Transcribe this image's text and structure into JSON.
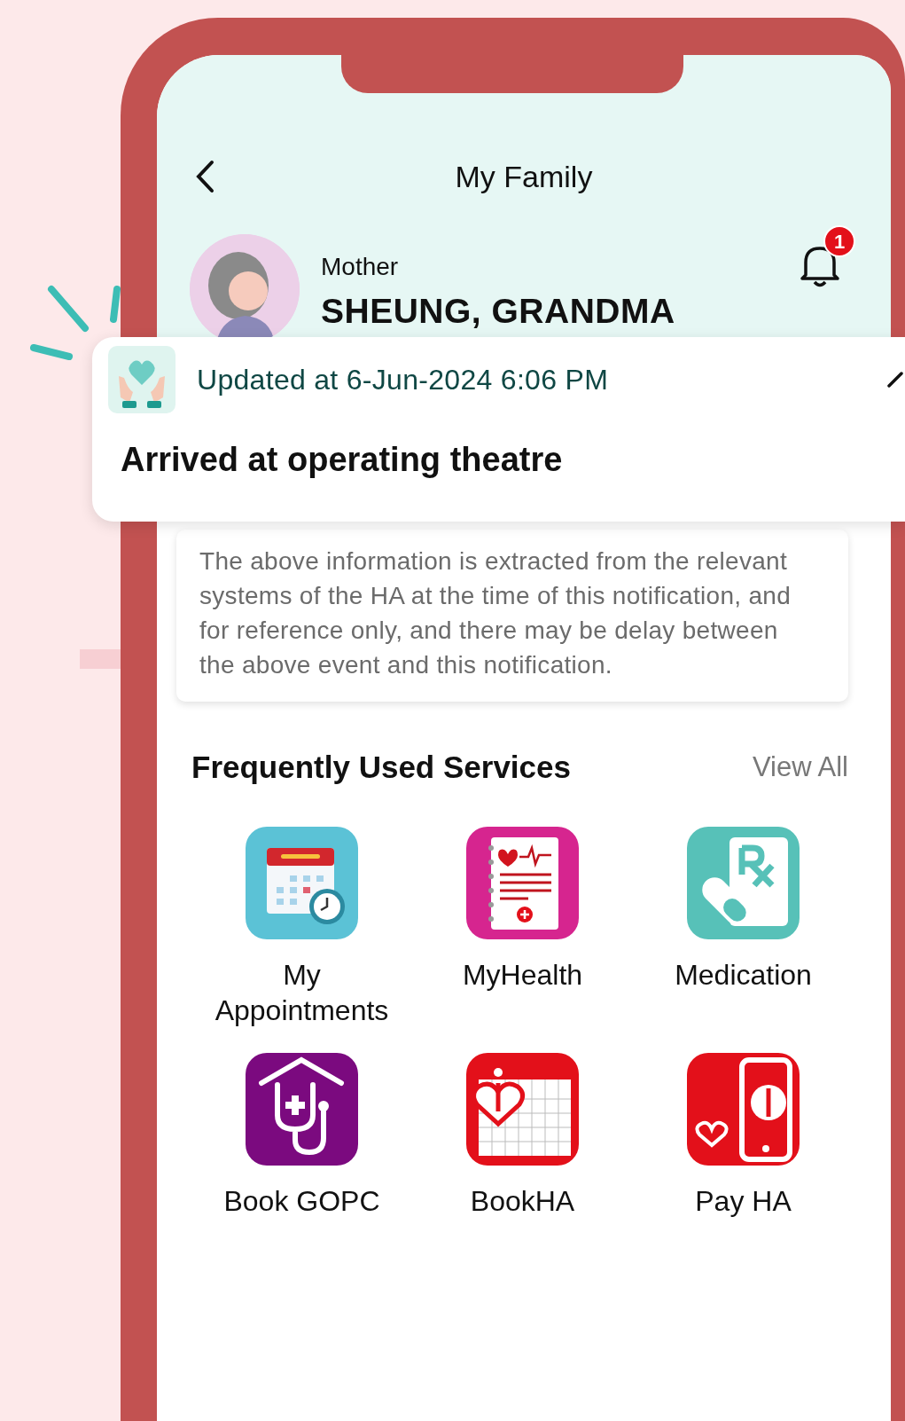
{
  "header": {
    "title": "My Family"
  },
  "profile": {
    "relation": "Mother",
    "name": "SHEUNG, GRANDMA",
    "notification_badge": "1"
  },
  "notification_card": {
    "updated": "Updated at 6-Jun-2024 6:06 PM",
    "status": "Arrived at operating theatre"
  },
  "disclaimer": "The above information is extracted from the relevant systems of the HA at the time of this notification, and for reference only, and there may be delay between the above event and this notification.",
  "services": {
    "title": "Frequently Used Services",
    "view_all": "View All",
    "items": [
      {
        "label": "My Appointments",
        "kind": "appointments"
      },
      {
        "label": "MyHealth",
        "kind": "health"
      },
      {
        "label": "Medication",
        "kind": "medication"
      },
      {
        "label": "Book GOPC",
        "kind": "clinic"
      },
      {
        "label": "BookHA",
        "kind": "calendar"
      },
      {
        "label": "Pay HA",
        "kind": "payment"
      }
    ]
  }
}
